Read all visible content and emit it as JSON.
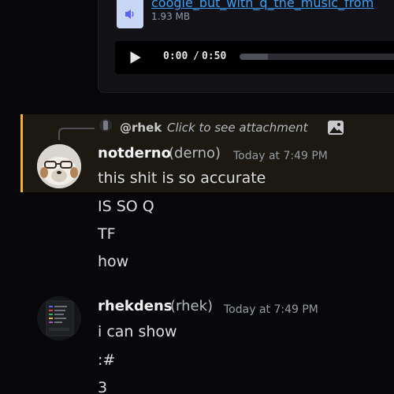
{
  "attachment": {
    "file_name": "coogle_but_with_q_the_music_from",
    "file_size": "1.93 MB",
    "player": {
      "current_time": "0:00",
      "separator": "/",
      "total_time": "0:50",
      "progress_fraction": 0.0,
      "buffered_fraction": 0.18
    }
  },
  "reply": {
    "user": "@rhek",
    "text": "Click to see attachment"
  },
  "messages": [
    {
      "username": "notderno",
      "nickname": "(derno)",
      "timestamp": "Today at 7:49 PM",
      "lines": [
        "this shit is so accurate",
        "IS SO Q",
        "TF",
        "how"
      ]
    },
    {
      "username": "rhekdens",
      "nickname": "(rhek)",
      "timestamp": "Today at 7:49 PM",
      "lines": [
        "i can show",
        ":#",
        "3"
      ]
    }
  ],
  "colors": {
    "background": "#070709",
    "link": "#3a9ff5",
    "mention_bar": "#f0b132",
    "mention_bg": "#1c1912",
    "seek_fill": "#5865f2"
  },
  "icons": [
    "speaker-file-icon",
    "play-icon",
    "image-icon"
  ]
}
